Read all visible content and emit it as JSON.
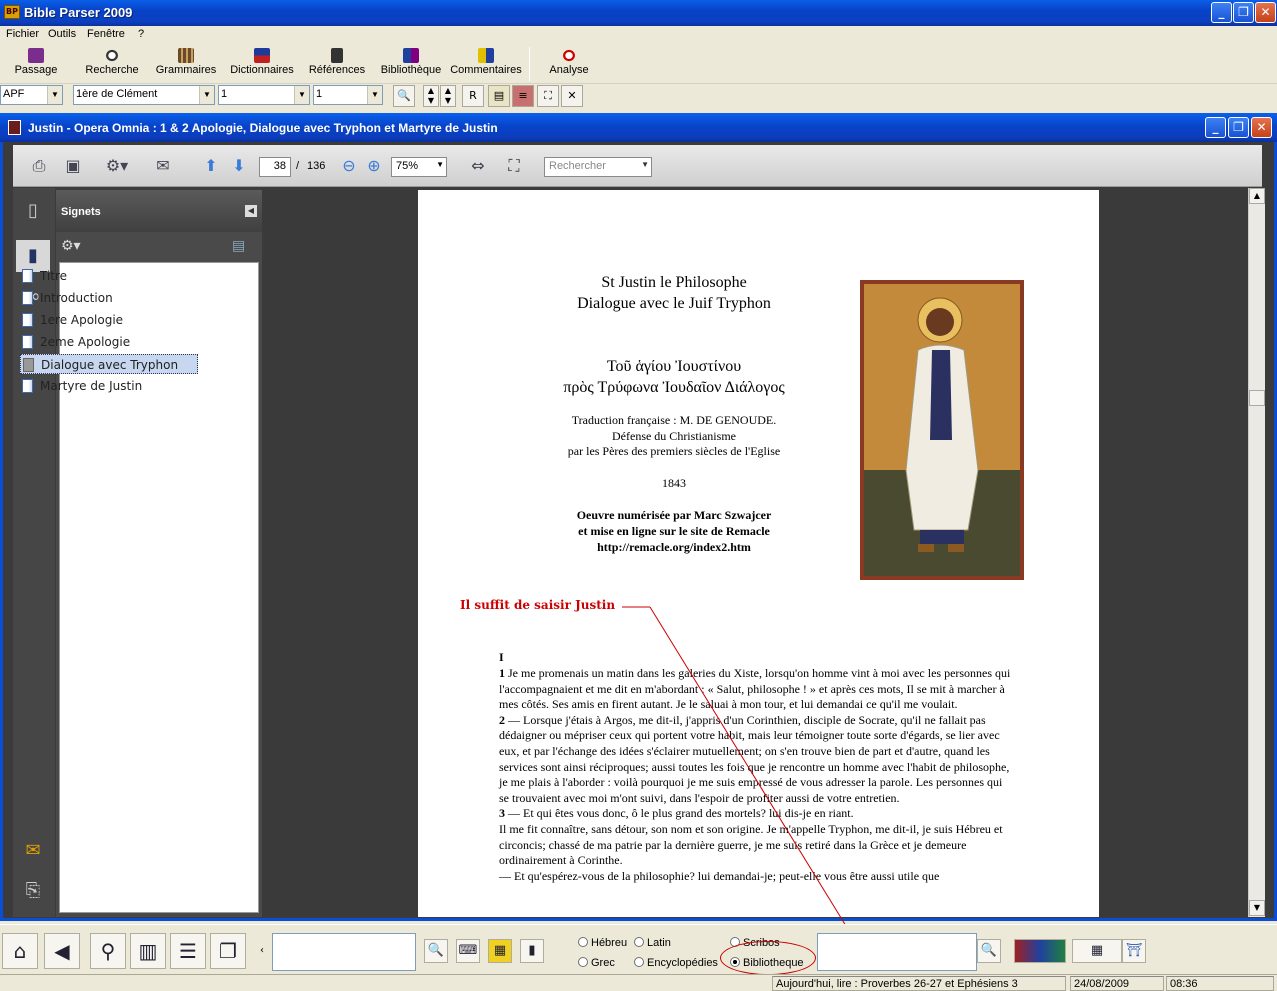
{
  "window": {
    "title": "Bible Parser 2009",
    "icon_text": "BP"
  },
  "menu": [
    "Fichier",
    "Outils",
    "Fenêtre",
    "?"
  ],
  "toolbar": {
    "buttons": [
      "Passage",
      "Recherche",
      "Grammaires",
      "Dictionnaires",
      "Références",
      "Bibliothèque",
      "Commentaires",
      "Analyse"
    ]
  },
  "selectors": {
    "version": "APF",
    "book": "1ère de Clément",
    "chapter": "1",
    "verse": "1",
    "r_button": "R"
  },
  "doc_window": {
    "title": "Justin - Opera Omnia : 1 & 2 Apologie, Dialogue avec Tryphon et Martyre de Justin"
  },
  "pdf_toolbar": {
    "page_current": "38",
    "page_sep": "/",
    "page_total": "136",
    "zoom": "75%",
    "search_placeholder": "Rechercher"
  },
  "bookmarks": {
    "title": "Signets",
    "items": [
      {
        "label": "Titre",
        "selected": false
      },
      {
        "label": "Introduction",
        "selected": false
      },
      {
        "label": "1ere Apologie",
        "selected": false
      },
      {
        "label": "2eme Apologie",
        "selected": false
      },
      {
        "label": "Dialogue avec Tryphon",
        "selected": true
      },
      {
        "label": "Martyre de Justin",
        "selected": false
      }
    ]
  },
  "page": {
    "title1": "St Justin le Philosophe",
    "title2": "Dialogue avec le Juif Tryphon",
    "greek1": "Τοῦ ἁγίου Ἰουστίνου",
    "greek2": "πρὸς Τρύφωνα Ἰουδαῖον Διάλογος",
    "trans1": "Traduction française : M. DE GENOUDE.",
    "trans2": "Défense du Christianisme",
    "trans3": "par les Pères des premiers siècles de l'Eglise",
    "year": "1843",
    "credit1": "Oeuvre numérisée par Marc Szwajcer",
    "credit2": "et mise en ligne sur le site de Remacle",
    "credit3": "http://remacle.org/index2.htm",
    "annotation": "Il suffit de saisir Justin",
    "chapter": "I",
    "body": [
      {
        "num": "1",
        "text": "Je me promenais un matin dans les galeries du Xiste, lorsqu'on homme vint à moi avec les personnes qui l'accompagnaient et me dit en m'abordant : « Salut, philosophe ! » et après ces mots, Il se mit à marcher à mes côtés. Ses amis en firent autant. Je le saluai à mon tour, et lui demandai ce qu'il me voulait."
      },
      {
        "num": "2",
        "text": "— Lorsque j'étais à Argos, me dit-il, j'appris d'un Corinthien, disciple de Socrate, qu'il ne fallait pas dédaigner ou mépriser ceux qui portent votre habit, mais leur témoigner toute sorte d'égards, se lier avec eux, et par l'échange des idées s'éclairer mutuellement; on s'en trouve bien de part et d'autre, quand les services sont ainsi réciproques; aussi toutes les fois que je rencontre un homme avec l'habit de philosophe, je me plais à l'aborder : voilà pourquoi je me suis empressé de vous adresser la parole. Les personnes qui se trouvaient avec moi m'ont suivi, dans l'espoir de profiter aussi de votre entretien."
      },
      {
        "num": "3",
        "text": "— Et qui êtes vous donc, ô le plus grand des mortels? lui dis-je en riant."
      },
      {
        "num": "",
        "text": "Il me fit connaître, sans détour, son nom et son origine. Je m'appelle Tryphon, me dit-il, je suis Hébreu et circoncis; chassé de ma patrie par la dernière guerre, je me suis retiré dans la Grèce et je demeure ordinairement à Corinthe."
      },
      {
        "num": "",
        "text": "— Et qu'espérez-vous de la philosophie? lui demandai-je; peut-elle vous être aussi utile que"
      }
    ]
  },
  "bottom": {
    "radios": [
      {
        "label": "Hébreu",
        "checked": false
      },
      {
        "label": "Latin",
        "checked": false
      },
      {
        "label": "Scribos",
        "checked": false
      },
      {
        "label": "Grec",
        "checked": false
      },
      {
        "label": "Encyclopédies",
        "checked": false
      },
      {
        "label": "Bibliotheque",
        "checked": true
      }
    ],
    "search_value": ""
  },
  "status": {
    "reading": "Aujourd'hui, lire : Proverbes 26-27 et Ephésiens 3",
    "date": "24/08/2009",
    "time": "08:36"
  },
  "colors": {
    "accent": "#0b4ed6",
    "annotation": "#cc0000",
    "icon_bg": "#6e2b1c"
  }
}
